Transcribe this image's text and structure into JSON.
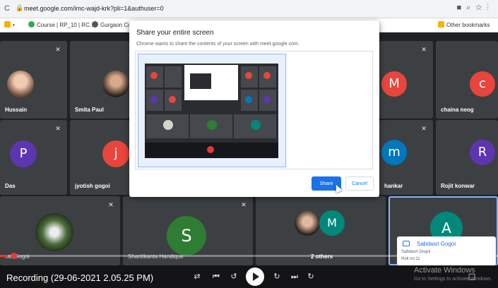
{
  "browser": {
    "url": "meet.google.com/imc-wajd-krk?pli=1&authuser=0",
    "bookmarks": [
      "Course | RP_10 | RC...",
      "Gurgaon Col"
    ],
    "other_bookmarks": "Other bookmarks"
  },
  "participants": [
    {
      "name": "Hussain",
      "type": "photo"
    },
    {
      "name": "Smita Paul",
      "type": "photo"
    },
    {
      "name": "",
      "initial": "M",
      "color": "#e8453c"
    },
    {
      "name": "chaina neog",
      "initial": "c",
      "color": "#e8453c"
    },
    {
      "name": "Das",
      "initial": "P",
      "color": "#5e35b1"
    },
    {
      "name": "jyotish gogoi",
      "initial": "j",
      "color": "#e8453c"
    },
    {
      "name": "hankar",
      "initial": "m",
      "color": "#0277bd"
    },
    {
      "name": "Rojit konwar",
      "initial": "R",
      "color": "#5e35b1"
    },
    {
      "name": "rati Gogoi",
      "type": "photo"
    },
    {
      "name": "Shantikanta Handique",
      "initial": "S",
      "color": "#2e7d32"
    },
    {
      "name": "2 others",
      "initial": "M",
      "color": "#00897b"
    },
    {
      "name": "",
      "initial": "A",
      "color": "#00897b"
    }
  ],
  "dialog": {
    "title": "Share your entire screen",
    "subtitle": "Chrome wants to share the contents of your screen with meet.google.com.",
    "share_label": "Share",
    "cancel_label": "Cancel"
  },
  "notification": {
    "name": "Sabdasri Gogoi",
    "line2": "Sabdasri Gogoi",
    "line3": "Roll no:11"
  },
  "player": {
    "recording_label": "Recording (29-06-2021 2.05.25 PM)",
    "progress_fraction": 0.015
  },
  "watermark": {
    "line1": "Activate Windows",
    "line2": "Go to Settings to activate Windows."
  },
  "icons": [
    "lock-icon",
    "mic-off-icon",
    "shuffle-icon",
    "previous-icon",
    "rewind-icon",
    "play-icon",
    "forward-icon",
    "next-icon",
    "repeat-icon",
    "chat-icon"
  ]
}
